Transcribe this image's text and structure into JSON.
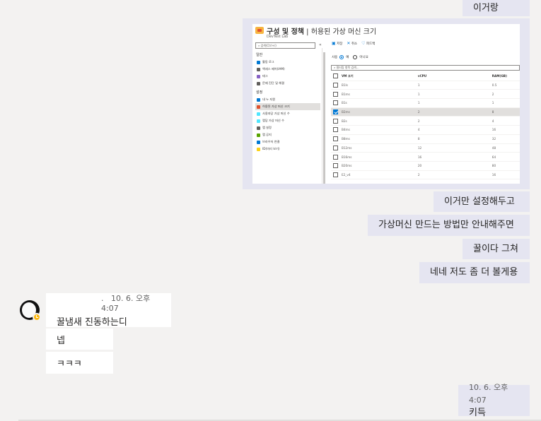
{
  "messages_top": {
    "m1": "이거랑"
  },
  "screenshot": {
    "title_bold": "구성 및 정책",
    "title_rest": " | 허용된 가상 머신 크기",
    "subtitle": "DevTest Lab",
    "search_placeholder": "검색(Ctrl+/)",
    "collapse": "«",
    "commands": {
      "save": "저장",
      "cancel": "취소",
      "feedback": "피드백"
    },
    "use_label": "사용",
    "use_yes": "예",
    "use_no": "아니요",
    "filter_placeholder": "필터링 항목 검색...",
    "sections": {
      "general": "일반",
      "settings": "설정"
    },
    "general_items": [
      "활동 로그",
      "액세스 제어(IAM)",
      "태그",
      "문제 진단 및 해결"
    ],
    "settings_items": [
      "내 누 지원",
      "허용된 가상 머신 크기",
      "사용자당 가상 머신 수",
      "랩당 가상 머신 수",
      "랩 설정",
      "랩 공지",
      "브라우저 연결",
      "ID(미리 보기)"
    ],
    "columns": {
      "vm": "VM 크기",
      "vcpu": "vCPU",
      "ram": "RAM(GB)"
    },
    "rows": [
      {
        "vm": "B1ls",
        "vcpu": "1",
        "ram": "0.5"
      },
      {
        "vm": "B1ms",
        "vcpu": "1",
        "ram": "2"
      },
      {
        "vm": "B1s",
        "vcpu": "1",
        "ram": "1"
      },
      {
        "vm": "B2ms",
        "vcpu": "2",
        "ram": "8"
      },
      {
        "vm": "B2s",
        "vcpu": "2",
        "ram": "4"
      },
      {
        "vm": "B4ms",
        "vcpu": "4",
        "ram": "16"
      },
      {
        "vm": "B8ms",
        "vcpu": "8",
        "ram": "32"
      },
      {
        "vm": "B12ms",
        "vcpu": "12",
        "ram": "48"
      },
      {
        "vm": "B16ms",
        "vcpu": "16",
        "ram": "64"
      },
      {
        "vm": "B20ms",
        "vcpu": "20",
        "ram": "80"
      },
      {
        "vm": "E2_v4",
        "vcpu": "2",
        "ram": "16"
      }
    ],
    "selected_row": 3
  },
  "messages_me": {
    "m2": "이거만 설정해두고",
    "m3": "가상머신 만드는 방법만 안내해주면",
    "m4": "꿀이다 그쳐",
    "m5": "네네 저도 좀 더 볼게용"
  },
  "other": {
    "sender_dot": ".",
    "time": "10. 6. 오후 4:07",
    "m1": "꿀냄새 진동하는디",
    "m2": "넵",
    "m3": "ㅋㅋㅋ"
  },
  "last": {
    "time": "10. 6. 오후 4:07",
    "text": "키득"
  },
  "colors": {
    "my_bubble": "#e5e5f1",
    "their_bubble": "#ffffff",
    "background": "#f3f2f1",
    "accent": "#0078d4",
    "status": "#fdb913"
  }
}
